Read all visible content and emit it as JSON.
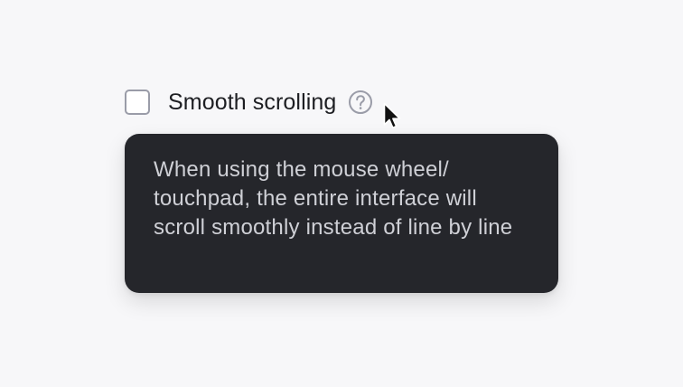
{
  "setting": {
    "label": "Smooth scrolling",
    "checked": false,
    "help_icon": "question-circle-icon"
  },
  "tooltip": {
    "text": "When using the mouse wheel/ touchpad, the entire interface will scroll smoothly instead of line by line"
  },
  "cursor": {
    "icon": "pointer-arrow-icon"
  },
  "colors": {
    "background": "#f7f7f9",
    "tooltip_background": "#25262b",
    "tooltip_text": "#cfd0d6",
    "label_text": "#1d1e22",
    "checkbox_border": "#9a9ca8",
    "help_icon": "#9a9ca8"
  }
}
